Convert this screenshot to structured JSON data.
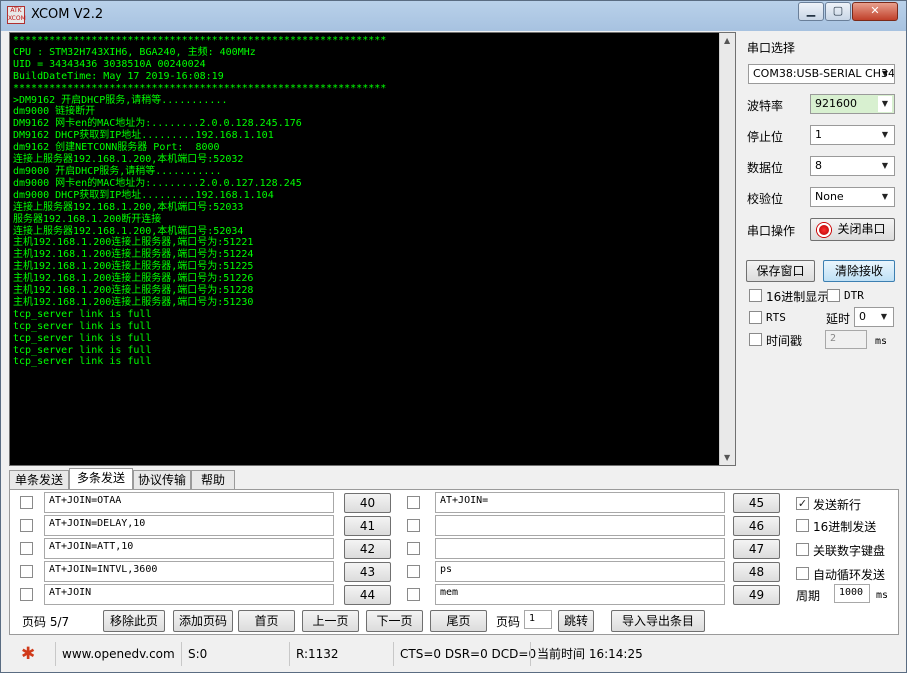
{
  "window": {
    "title": "XCOM V2.2",
    "logo_text": "ATK XCOM"
  },
  "terminal": {
    "lines": [
      "**************************************************************",
      "CPU : STM32H743XIH6, BGA240, 主频: 400MHz",
      "UID = 34343436 3038510A 00240024",
      "BuildDateTime: May 17 2019-16:08:19",
      "**************************************************************",
      ">DM9162 开启DHCP服务,请稍等...........",
      "dm9000 链接断开",
      "DM9162 网卡en的MAC地址为:........2.0.0.128.245.176",
      "DM9162 DHCP获取到IP地址.........192.168.1.101",
      "dm9162 创建NETCONN服务器 Port:  8000",
      "连接上服务器192.168.1.200,本机端口号:52032",
      "dm9000 开启DHCP服务,请稍等...........",
      "dm9000 网卡en的MAC地址为:........2.0.0.127.128.245",
      "dm9000 DHCP获取到IP地址.........192.168.1.104",
      "连接上服务器192.168.1.200,本机端口号:52033",
      "服务器192.168.1.200断开连接",
      "连接上服务器192.168.1.200,本机端口号:52034",
      "主机192.168.1.200连接上服务器,端口号为:51221",
      "主机192.168.1.200连接上服务器,端口号为:51224",
      "主机192.168.1.200连接上服务器,端口号为:51225",
      "主机192.168.1.200连接上服务器,端口号为:51226",
      "主机192.168.1.200连接上服务器,端口号为:51228",
      "主机192.168.1.200连接上服务器,端口号为:51230",
      "tcp_server link is full",
      "tcp_server link is full",
      "tcp_server link is full",
      "tcp_server link is full",
      "tcp_server link is full"
    ],
    "text_color": "#00ff00"
  },
  "settings": {
    "port_label": "串口选择",
    "port_value": "COM38:USB-SERIAL CH34",
    "baud_label": "波特率",
    "baud_value": "921600",
    "stopbits_label": "停止位",
    "stopbits_value": "1",
    "databits_label": "数据位",
    "databits_value": "8",
    "parity_label": "校验位",
    "parity_value": "None",
    "port_op_label": "串口操作",
    "close_port_label": "关闭串口",
    "save_window_label": "保存窗口",
    "clear_recv_label": "清除接收",
    "hex_display_label": "16进制显示",
    "dtr_label": "DTR",
    "rts_label": "RTS",
    "delay_label": "延时",
    "delay_value": "0",
    "timestamp_label": "时间戳",
    "timestamp_value": "2",
    "ms_label": "ms"
  },
  "tabs": [
    "单条发送",
    "多条发送",
    "协议传输",
    "帮助"
  ],
  "multi_send": {
    "left": [
      {
        "text": "AT+JOIN=OTAA",
        "btn": "40"
      },
      {
        "text": "AT+JOIN=DELAY,10",
        "btn": "41"
      },
      {
        "text": "AT+JOIN=ATT,10",
        "btn": "42"
      },
      {
        "text": "AT+JOIN=INTVL,3600",
        "btn": "43"
      },
      {
        "text": "AT+JOIN",
        "btn": "44"
      }
    ],
    "right": [
      {
        "text": "AT+JOIN=",
        "btn": "45"
      },
      {
        "text": "",
        "btn": "46"
      },
      {
        "text": "",
        "btn": "47"
      },
      {
        "text": "ps",
        "btn": "48"
      },
      {
        "text": "mem",
        "btn": "49"
      }
    ],
    "opts": {
      "newline_label": "发送新行",
      "hex_send_label": "16进制发送",
      "keypad_label": "关联数字键盘",
      "loop_label": "自动循环发送",
      "period_label": "周期",
      "period_value": "1000",
      "ms_label": "ms"
    },
    "bottom": {
      "page_label": "页码 5/7",
      "remove_page": "移除此页",
      "add_page": "添加页码",
      "first": "首页",
      "prev": "上一页",
      "next": "下一页",
      "last": "尾页",
      "goto_label": "页码",
      "goto_value": "1",
      "jump": "跳转",
      "import_export": "导入导出条目"
    }
  },
  "statusbar": {
    "url": "www.openedv.com",
    "sent": "S:0",
    "recv": "R:1132",
    "lines": "CTS=0 DSR=0 DCD=0",
    "time": "当前时间 16:14:25"
  }
}
